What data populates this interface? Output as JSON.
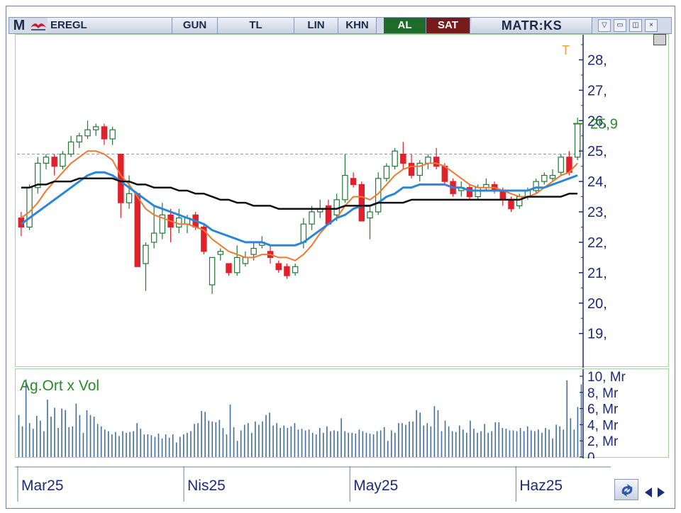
{
  "toolbar": {
    "logo": "M",
    "symbol": "EREGL",
    "period": "GUN",
    "currency": "TL",
    "scale": "LIN",
    "chart_kind": "KHN",
    "buy_label": "AL",
    "sell_label": "SAT",
    "brand": "MATR:KS",
    "icons": [
      "bird-logo-icon",
      "dropdown-icon",
      "minimize-icon",
      "restore-icon",
      "close-icon"
    ]
  },
  "colors": {
    "up_candle": "#1f7a36",
    "down_candle": "#e0202a",
    "ma_short": "#f07830",
    "ma_mid": "#2a86d6",
    "ma_long": "#101010",
    "current_price": "#2a8a2a",
    "volume": "#3e6f9e",
    "dashed_level": "#8f8fe0",
    "axis": "#1b2a7a"
  },
  "chart_data": {
    "type": "candlestick",
    "price_axis": {
      "ticks": [
        "28,",
        "27,",
        "26,",
        "25,",
        "24,",
        "23,",
        "22,",
        "21,",
        "20,",
        "19,"
      ],
      "ylim": [
        18.2,
        28.5
      ]
    },
    "current_price_label": "25,9",
    "current_price": 25.9,
    "dashed_level": 24.9,
    "marker_label": "T",
    "x_labels": [
      {
        "label": "Mar25",
        "index": 0
      },
      {
        "label": "Nis25",
        "index": 20
      },
      {
        "label": "May25",
        "index": 40
      },
      {
        "label": "Haz25",
        "index": 60
      }
    ],
    "candles": [
      [
        22.8,
        23.0,
        22.2,
        22.5
      ],
      [
        22.5,
        23.9,
        22.4,
        23.8
      ],
      [
        23.8,
        24.8,
        23.6,
        24.6
      ],
      [
        24.6,
        24.9,
        24.4,
        24.8
      ],
      [
        24.8,
        24.9,
        24.2,
        24.5
      ],
      [
        24.5,
        25.0,
        24.4,
        24.9
      ],
      [
        24.9,
        25.5,
        24.8,
        25.3
      ],
      [
        25.3,
        25.6,
        25.1,
        25.5
      ],
      [
        25.5,
        26.0,
        25.4,
        25.7
      ],
      [
        25.7,
        25.9,
        25.5,
        25.8
      ],
      [
        25.8,
        25.9,
        25.2,
        25.4
      ],
      [
        25.4,
        25.8,
        25.2,
        25.7
      ],
      [
        24.9,
        24.9,
        22.8,
        23.3
      ],
      [
        23.3,
        24.2,
        23.1,
        23.6
      ],
      [
        23.6,
        23.6,
        21.2,
        21.2
      ],
      [
        21.3,
        22.0,
        20.4,
        21.9
      ],
      [
        22.0,
        23.2,
        21.8,
        22.3
      ],
      [
        22.3,
        23.3,
        22.1,
        22.9
      ],
      [
        22.9,
        23.1,
        22.0,
        22.5
      ],
      [
        22.5,
        23.1,
        22.3,
        22.8
      ],
      [
        22.6,
        22.9,
        22.3,
        22.8
      ],
      [
        22.9,
        23.0,
        22.4,
        22.5
      ],
      [
        22.5,
        22.6,
        21.6,
        21.7
      ],
      [
        20.6,
        21.5,
        20.3,
        21.5
      ],
      [
        21.6,
        21.8,
        21.4,
        21.7
      ],
      [
        21.3,
        21.3,
        20.9,
        21.0
      ],
      [
        21.0,
        21.9,
        20.9,
        21.5
      ],
      [
        21.3,
        21.7,
        21.2,
        21.5
      ],
      [
        21.6,
        22.0,
        21.4,
        21.8
      ],
      [
        21.9,
        22.2,
        21.8,
        22.0
      ],
      [
        21.7,
        21.9,
        21.3,
        21.5
      ],
      [
        21.3,
        21.4,
        21.0,
        21.1
      ],
      [
        21.2,
        21.3,
        20.8,
        20.9
      ],
      [
        21.0,
        21.3,
        20.9,
        21.2
      ],
      [
        22.0,
        22.8,
        21.8,
        22.6
      ],
      [
        22.6,
        23.2,
        22.4,
        23.0
      ],
      [
        23.0,
        23.4,
        22.8,
        23.1
      ],
      [
        23.2,
        23.4,
        22.8,
        22.6
      ],
      [
        22.9,
        23.6,
        22.7,
        23.4
      ],
      [
        23.4,
        24.9,
        23.3,
        24.2
      ],
      [
        24.1,
        24.3,
        23.8,
        23.9
      ],
      [
        23.9,
        24.0,
        22.9,
        22.7
      ],
      [
        22.8,
        23.2,
        22.1,
        23.0
      ],
      [
        23.0,
        24.3,
        22.9,
        24.1
      ],
      [
        24.1,
        24.6,
        24.0,
        24.5
      ],
      [
        24.5,
        25.1,
        24.4,
        25.0
      ],
      [
        24.9,
        25.3,
        24.4,
        24.6
      ],
      [
        24.6,
        24.9,
        24.1,
        24.2
      ],
      [
        24.2,
        24.7,
        24.0,
        24.6
      ],
      [
        24.6,
        24.9,
        24.4,
        24.8
      ],
      [
        24.8,
        25.1,
        24.4,
        24.5
      ],
      [
        24.5,
        24.6,
        23.9,
        24.0
      ],
      [
        24.0,
        24.1,
        23.5,
        23.6
      ],
      [
        23.7,
        24.0,
        23.5,
        23.8
      ],
      [
        23.8,
        23.9,
        23.4,
        23.5
      ],
      [
        23.5,
        23.9,
        23.4,
        23.8
      ],
      [
        23.8,
        24.1,
        23.7,
        23.9
      ],
      [
        23.9,
        24.0,
        23.6,
        23.7
      ],
      [
        23.7,
        23.8,
        23.2,
        23.4
      ],
      [
        23.4,
        23.5,
        23.0,
        23.1
      ],
      [
        23.2,
        23.6,
        23.1,
        23.5
      ],
      [
        23.5,
        23.8,
        23.4,
        23.7
      ],
      [
        23.7,
        24.1,
        23.6,
        24.0
      ],
      [
        24.0,
        24.3,
        23.9,
        24.2
      ],
      [
        24.1,
        24.4,
        24.0,
        24.2
      ],
      [
        24.3,
        24.9,
        24.2,
        24.8
      ],
      [
        24.8,
        25.0,
        24.2,
        24.3
      ],
      [
        24.8,
        26.1,
        24.7,
        25.9
      ]
    ],
    "series": [
      {
        "values": [
          22.8,
          23.0,
          23.3,
          23.7,
          24.0,
          24.3,
          24.6,
          24.8,
          25.0,
          25.0,
          24.9,
          24.7,
          24.2,
          23.9,
          23.5,
          23.1,
          22.9,
          22.8,
          22.7,
          22.6,
          22.6,
          22.5,
          22.4,
          22.1,
          21.9,
          21.7,
          21.6,
          21.5,
          21.5,
          21.6,
          21.6,
          21.5,
          21.5,
          21.4,
          21.6,
          21.9,
          22.3,
          22.6,
          22.8,
          23.2,
          23.5,
          23.5,
          23.4,
          23.6,
          23.9,
          24.2,
          24.4,
          24.5,
          24.5,
          24.6,
          24.6,
          24.5,
          24.3,
          24.1,
          23.9,
          23.8,
          23.8,
          23.8,
          23.7,
          23.6,
          23.5,
          23.5,
          23.6,
          23.8,
          24.0,
          24.2,
          24.3,
          24.6
        ]
      },
      {
        "values": [
          22.6,
          22.8,
          23.0,
          23.2,
          23.4,
          23.6,
          23.8,
          24.0,
          24.2,
          24.3,
          24.3,
          24.2,
          24.0,
          23.8,
          23.6,
          23.4,
          23.2,
          23.1,
          23.0,
          22.9,
          22.8,
          22.7,
          22.6,
          22.4,
          22.3,
          22.2,
          22.1,
          22.0,
          22.0,
          22.0,
          21.9,
          21.9,
          21.9,
          21.9,
          22.0,
          22.2,
          22.4,
          22.6,
          22.8,
          22.9,
          23.1,
          23.2,
          23.2,
          23.3,
          23.5,
          23.6,
          23.8,
          23.8,
          23.9,
          23.9,
          23.9,
          23.9,
          23.8,
          23.8,
          23.7,
          23.7,
          23.7,
          23.7,
          23.7,
          23.7,
          23.7,
          23.7,
          23.8,
          23.8,
          23.9,
          24.0,
          24.1,
          24.2
        ]
      },
      {
        "values": [
          23.8,
          23.8,
          23.9,
          23.9,
          24.0,
          24.0,
          24.0,
          24.1,
          24.1,
          24.1,
          24.1,
          24.1,
          24.0,
          24.0,
          23.9,
          23.9,
          23.8,
          23.8,
          23.8,
          23.7,
          23.7,
          23.6,
          23.6,
          23.5,
          23.4,
          23.4,
          23.3,
          23.3,
          23.2,
          23.2,
          23.2,
          23.1,
          23.1,
          23.1,
          23.1,
          23.1,
          23.1,
          23.1,
          23.1,
          23.2,
          23.2,
          23.2,
          23.2,
          23.3,
          23.3,
          23.3,
          23.3,
          23.4,
          23.4,
          23.4,
          23.4,
          23.4,
          23.4,
          23.4,
          23.4,
          23.4,
          23.4,
          23.4,
          23.4,
          23.4,
          23.4,
          23.5,
          23.5,
          23.5,
          23.5,
          23.5,
          23.6,
          23.6
        ]
      }
    ],
    "volume": {
      "label": "Ag.Ort x Vol",
      "ticks": [
        "10, Mr",
        "8, Mr",
        "6, Mr",
        "4, Mr",
        "2, Mr",
        "0,"
      ],
      "ylim": [
        0,
        10
      ],
      "values": [
        5.2,
        3.8,
        9.6,
        4.2,
        3.5,
        5.1,
        4.5,
        3.2,
        7.1,
        5.0,
        6.1,
        3.6,
        6.0,
        5.8,
        3.7,
        3.8,
        6.6,
        5.2,
        3.0,
        5.8,
        5.2,
        5.0,
        4.1,
        3.8,
        3.4,
        3.2,
        2.8,
        3.1,
        2.6,
        3.2,
        3.0,
        3.1,
        3.2,
        4.2,
        3.5,
        2.8,
        2.8,
        2.7,
        2.5,
        2.9,
        2.3,
        2.8,
        2.4,
        2.8,
        1.8,
        2.5,
        2.8,
        3.0,
        3.2,
        4.1,
        4.2,
        5.7,
        5.6,
        4.5,
        4.4,
        4.3,
        4.6,
        3.6,
        2.8,
        6.5,
        3.7,
        2.0,
        3.3,
        4.0,
        4.2,
        3.0,
        4.4,
        4.0,
        4.4,
        5.2,
        5.5,
        3.9,
        4.2,
        3.6,
        3.9,
        3.6,
        3.8,
        4.2,
        3.4,
        3.5,
        3.3,
        3.4,
        3.0,
        2.8,
        3.6,
        3.0,
        3.8,
        3.2,
        3.3,
        3.2,
        4.8,
        3.2,
        3.0,
        3.0,
        2.9,
        3.4,
        3.2,
        3.0,
        2.9,
        2.8,
        3.2,
        3.3,
        3.7,
        2.0,
        3.3,
        3.0,
        4.2,
        4.2,
        4.0,
        4.4,
        4.4,
        5.8,
        5.5,
        3.9,
        4.2,
        3.8,
        6.3,
        5.8,
        3.2,
        4.5,
        3.8,
        3.2,
        3.1,
        3.9,
        3.4,
        3.0,
        4.5,
        3.5,
        3.0,
        3.2,
        4.1,
        3.0,
        3.2,
        4.3,
        4.3,
        3.6,
        3.5,
        3.3,
        3.3,
        3.2,
        3.6,
        3.2,
        3.8,
        3.3,
        3.2,
        3.4,
        3.0,
        3.6,
        3.4,
        2.3,
        4.0,
        3.8,
        3.4,
        9.5,
        4.8,
        3.4,
        6.2,
        9.0
      ]
    }
  }
}
